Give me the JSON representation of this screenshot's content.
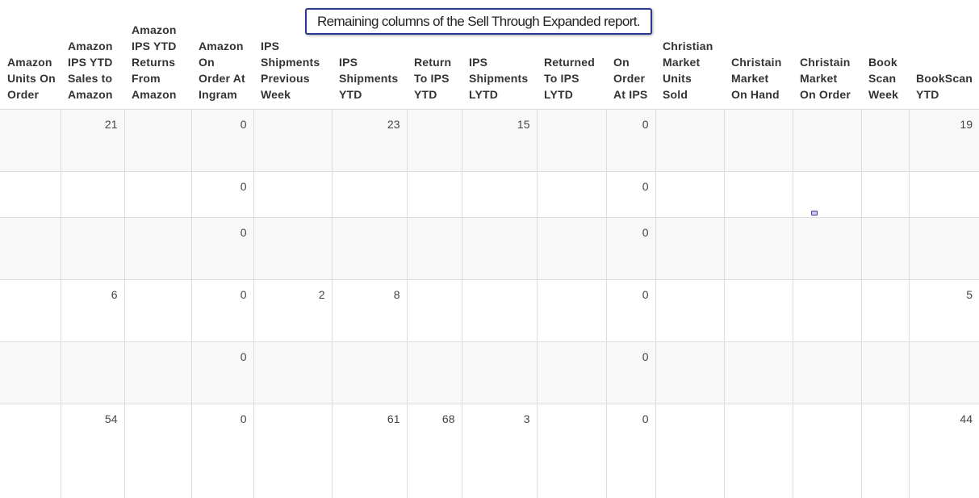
{
  "callout": {
    "text": "Remaining columns of the Sell Through Expanded report."
  },
  "table": {
    "columns": [
      "Amazon Units On Order",
      "Amazon IPS YTD Sales to Amazon",
      "Amazon IPS YTD Returns From Amazon",
      "Amazon On Order At Ingram",
      "IPS Shipments Previous Week",
      "IPS Shipments YTD",
      "Return To IPS YTD",
      "IPS Shipments LYTD",
      "Returned To IPS LYTD",
      "On Order At IPS",
      "Christian Market Units Sold",
      "Christain Market On Hand",
      "Christain Market On Order",
      "Book Scan Week",
      "BookScan YTD"
    ],
    "rows": [
      [
        "",
        "21",
        "",
        "0",
        "",
        "23",
        "",
        "15",
        "",
        "0",
        "",
        "",
        "",
        "",
        "19"
      ],
      [
        "",
        "",
        "",
        "0",
        "",
        "",
        "",
        "",
        "",
        "0",
        "",
        "",
        "",
        "",
        ""
      ],
      [
        "",
        "",
        "",
        "0",
        "",
        "",
        "",
        "",
        "",
        "0",
        "",
        "",
        "",
        "",
        ""
      ],
      [
        "",
        "6",
        "",
        "0",
        "2",
        "8",
        "",
        "",
        "",
        "0",
        "",
        "",
        "",
        "",
        "5"
      ],
      [
        "",
        "",
        "",
        "0",
        "",
        "",
        "",
        "",
        "",
        "0",
        "",
        "",
        "",
        "",
        ""
      ],
      [
        "",
        "54",
        "",
        "0",
        "",
        "61",
        "68",
        "3",
        "",
        "0",
        "",
        "",
        "",
        "",
        "44"
      ]
    ]
  }
}
